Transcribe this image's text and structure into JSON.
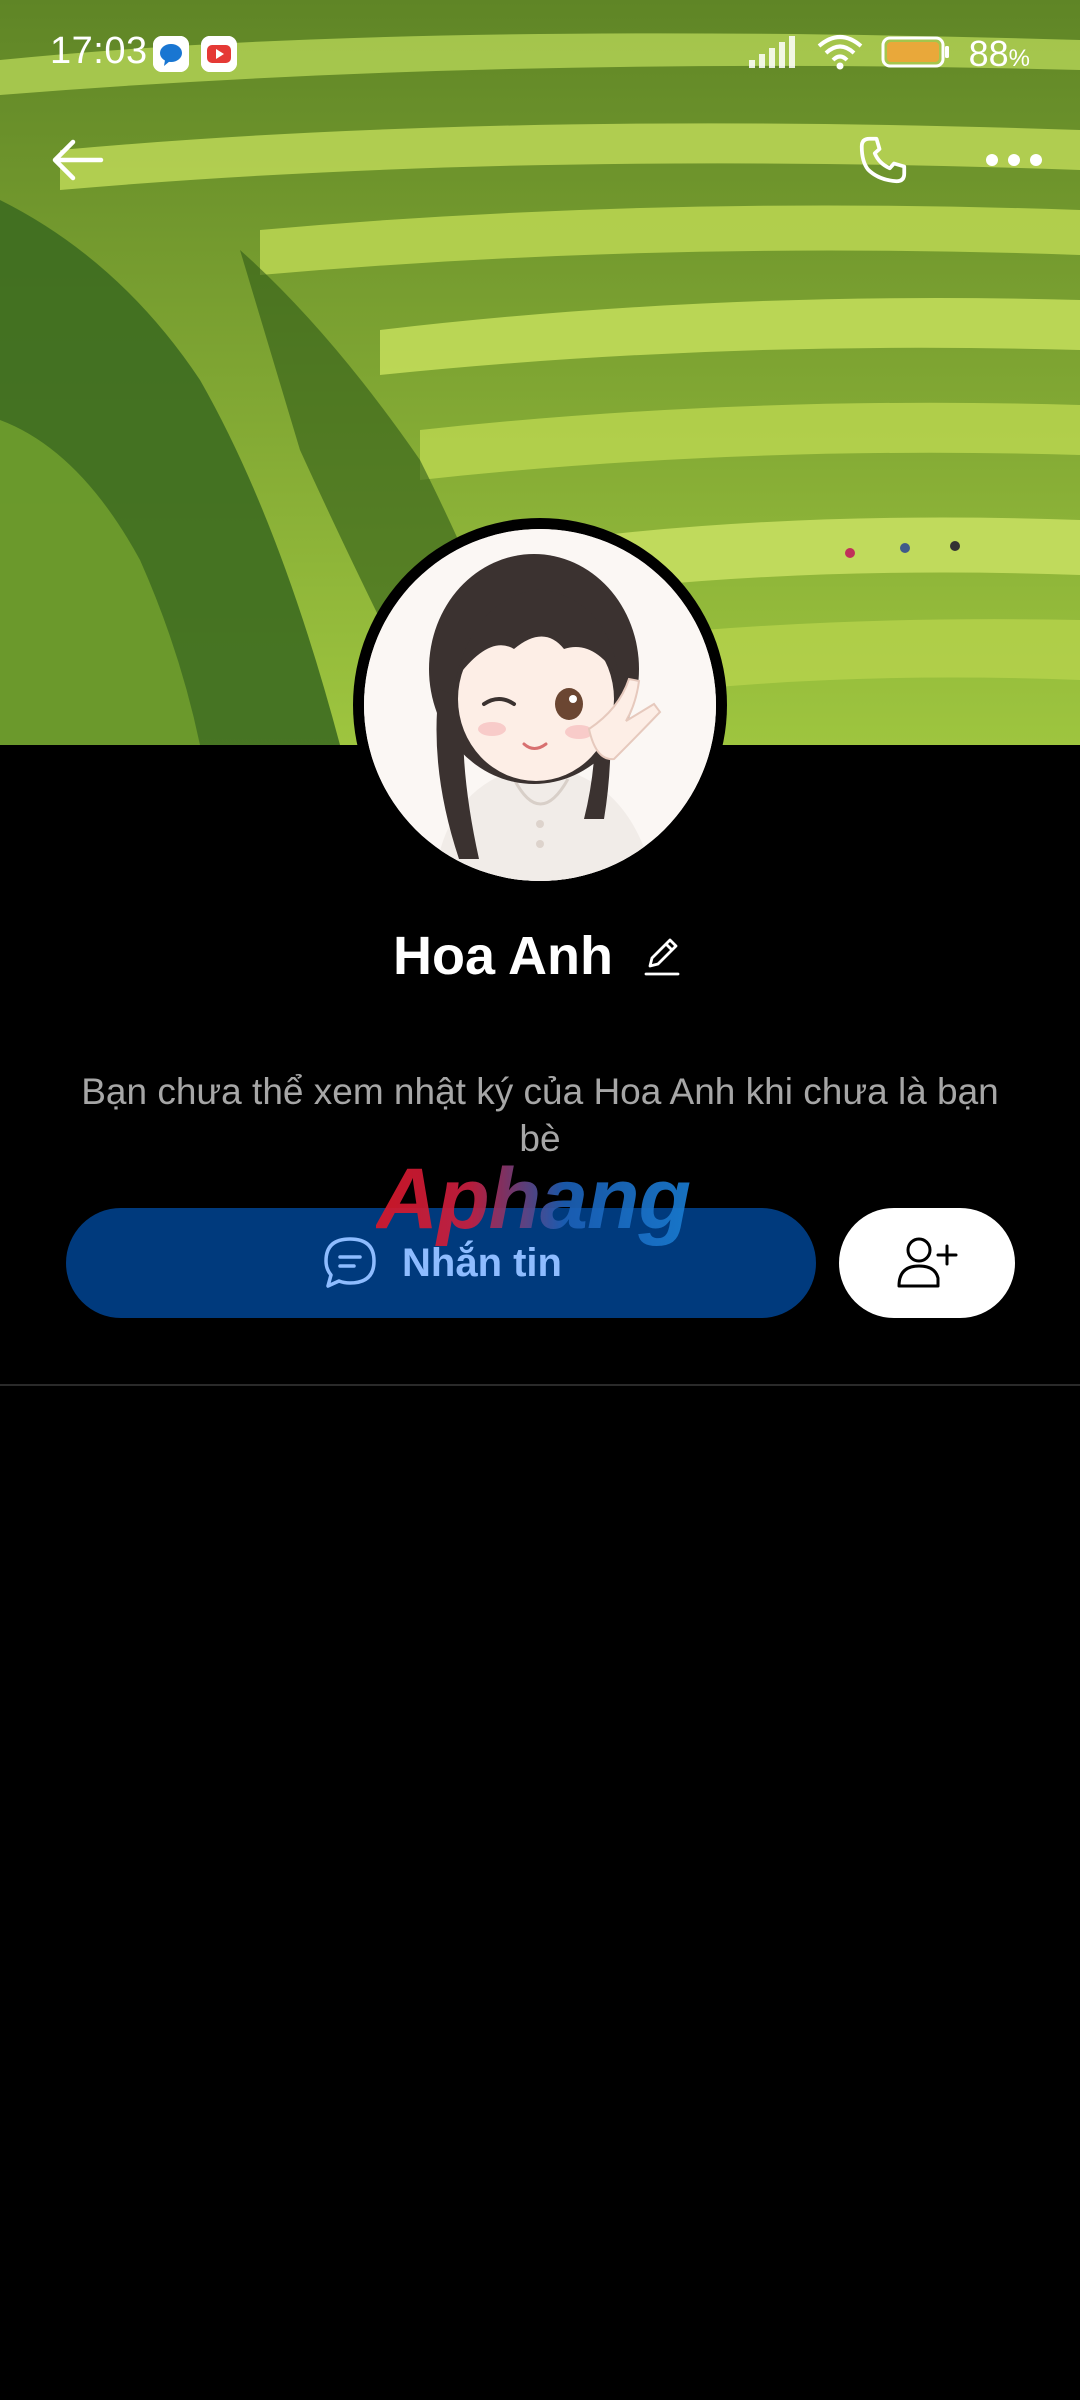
{
  "status_bar": {
    "time": "17:03",
    "battery_percent": "88",
    "battery_unit": "%",
    "notification_icons": [
      "messenger-icon",
      "youtube-icon"
    ]
  },
  "header": {
    "back_icon": "arrow-left-icon",
    "call_icon": "phone-icon",
    "more_icon": "more-dots-icon"
  },
  "profile": {
    "name": "Hoa Anh",
    "notice": "Bạn chưa thể xem nhật ký của Hoa Anh khi chưa là bạn bè"
  },
  "actions": {
    "message_label": "Nhắn tin",
    "add_friend_icon": "add-friend-icon"
  },
  "watermark": {
    "text": "Aphang"
  },
  "colors": {
    "message_button_bg": "#003a7d",
    "message_button_text": "#8ebcff",
    "background": "#000000"
  }
}
